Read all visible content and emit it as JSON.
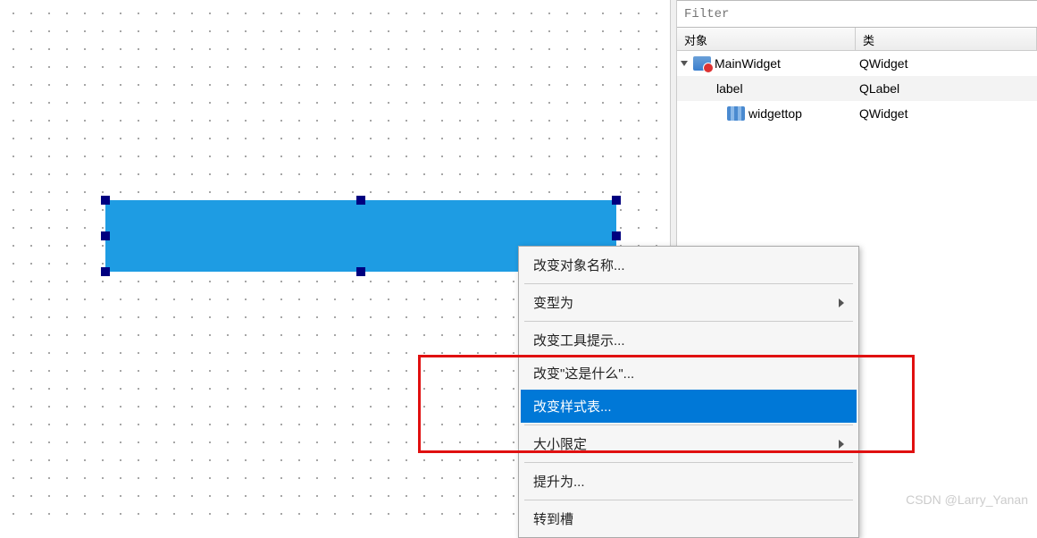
{
  "filter": {
    "placeholder": "Filter"
  },
  "tree": {
    "headers": {
      "object": "对象",
      "class": "类"
    },
    "rows": [
      {
        "name": "MainWidget",
        "class": "QWidget"
      },
      {
        "name": "label",
        "class": "QLabel"
      },
      {
        "name": "widgettop",
        "class": "QWidget"
      }
    ]
  },
  "context_menu": {
    "items": [
      {
        "label": "改变对象名称...",
        "submenu": false
      },
      {
        "label": "变型为",
        "submenu": true
      },
      {
        "label": "改变工具提示...",
        "submenu": false
      },
      {
        "label": "改变\"这是什么\"...",
        "submenu": false
      },
      {
        "label": "改变样式表...",
        "submenu": false,
        "highlighted": true
      },
      {
        "label": "大小限定",
        "submenu": true
      },
      {
        "label": "提升为...",
        "submenu": false
      },
      {
        "label": "转到槽",
        "submenu": false
      }
    ]
  },
  "watermark": "CSDN @Larry_Yanan"
}
